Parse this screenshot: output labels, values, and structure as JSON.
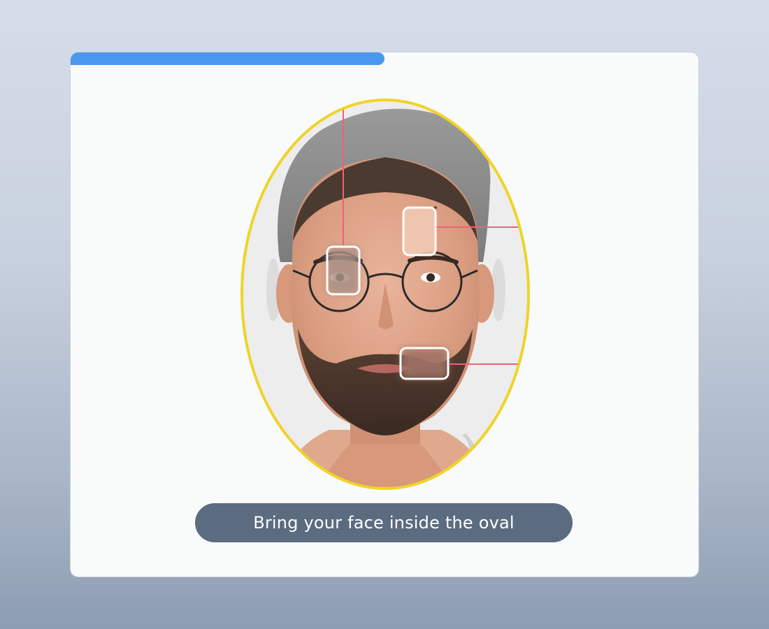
{
  "progress": {
    "value": 0.5
  },
  "instruction": {
    "text": "Bring your face inside the oval"
  },
  "colors": {
    "accent": "#4a97f0",
    "oval_border": "#f0d32a",
    "marker_line": "#f0607a",
    "instruction_bg": "#5b6b80"
  },
  "icons": {
    "face": "face-photo",
    "markers": [
      "forehead-marker",
      "eye-marker",
      "mouth-marker"
    ]
  }
}
